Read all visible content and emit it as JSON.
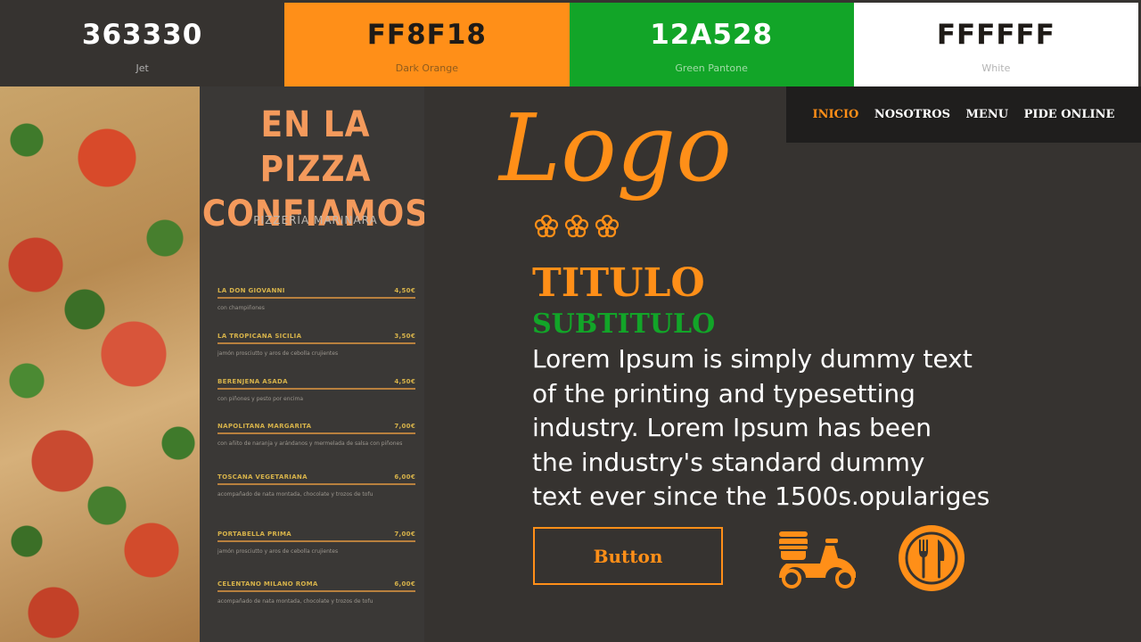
{
  "palette": [
    {
      "hex": "363330",
      "name": "Jet"
    },
    {
      "hex": "FF8F18",
      "name": "Dark Orange"
    },
    {
      "hex": "12A528",
      "name": "Green Pantone"
    },
    {
      "hex": "FFFFFF",
      "name": "White"
    }
  ],
  "colors": {
    "jet": "#363330",
    "accent": "#FF8F18",
    "green": "#12A528",
    "white": "#FFFFFF"
  },
  "flyer": {
    "title_line1": "EN LA PIZZA",
    "title_line2": "CONFIAMOS",
    "subtitle": "PIZZERÍA MARINARA",
    "items": [
      {
        "name": "LA DON GIOVANNI",
        "price": "4,50€",
        "desc": "con champiñones"
      },
      {
        "name": "LA TROPICANA SICILIA",
        "price": "3,50€",
        "desc": "jamón prosciutto y aros de cebolla crujientes"
      },
      {
        "name": "BERENJENA ASADA",
        "price": "4,50€",
        "desc": "con piñones y pesto por encima"
      },
      {
        "name": "NAPOLITANA MARGARITA",
        "price": "7,00€",
        "desc": "con añito de naranja y arándanos y mermelada de salsa con piñones"
      },
      {
        "name": "TOSCANA VEGETARIANA",
        "price": "6,00€",
        "desc": "acompañado de nata montada, chocolate y trozos de tofu"
      },
      {
        "name": "PORTABELLA PRIMA",
        "price": "7,00€",
        "desc": "jamón prosciutto y aros de cebolla crujientes"
      },
      {
        "name": "CELENTANO MILANO ROMA",
        "price": "6,00€",
        "desc": "acompañado de nata montada, chocolate y trozos de tofu"
      }
    ]
  },
  "nav": {
    "items": [
      "INICIO",
      "NOSOTROS",
      "MENU",
      "PIDE ONLINE"
    ]
  },
  "logo": {
    "text": "Logo"
  },
  "content": {
    "title": "TITULO",
    "subtitle": "SUBTITULO",
    "body_lines": [
      "Lorem Ipsum is simply dummy text",
      "of the printing and typesetting",
      "industry. Lorem Ipsum has been",
      "the industry's standard dummy",
      "text ever since the 1500s.opulariges"
    ],
    "button_label": "Button"
  },
  "icons": [
    "delivery-scooter-icon",
    "fork-knife-icon"
  ]
}
